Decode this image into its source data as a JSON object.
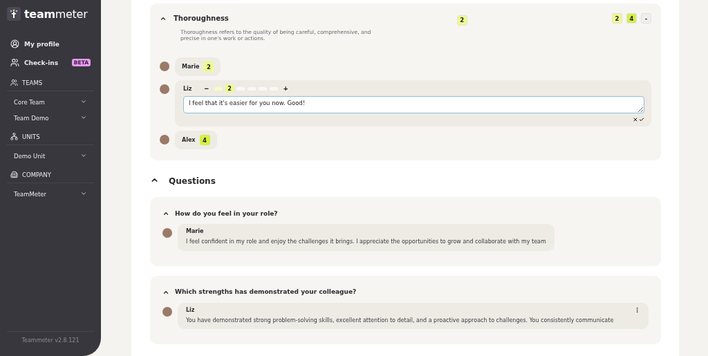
{
  "sidebar": {
    "logo": {
      "bold": "team",
      "light": "meter"
    },
    "nav": [
      {
        "kind": "profile",
        "label": "My profile"
      },
      {
        "kind": "checkins",
        "label": "Check-ins",
        "badge": "BETA"
      }
    ],
    "groups": [
      {
        "kind": "teams",
        "title": "TEAMS",
        "items": [
          {
            "label": "Core Team",
            "expanded": false
          },
          {
            "label": "Team Demo",
            "expanded": false
          }
        ]
      },
      {
        "kind": "units",
        "title": "UNITS",
        "items": [
          {
            "label": "Demo Unit",
            "expanded": false
          }
        ]
      },
      {
        "kind": "company",
        "title": "COMPANY",
        "items": [
          {
            "label": "TeamMeter",
            "expanded": false
          }
        ]
      }
    ],
    "version": "Teammeter v2.8.121"
  },
  "competency": {
    "title": "Thoroughness",
    "expanded": true,
    "description": "Thoroughness refers to the quality of being careful, comprehensive, and precise in one's work or actions.",
    "own_score": {
      "value": "2",
      "color": "#eefa8f"
    },
    "scores": [
      {
        "value": "2",
        "color": "#eefa8f"
      },
      {
        "value": "4",
        "color": "#d6ef48"
      },
      {
        "value": "-",
        "color": "#eeeef0"
      }
    ],
    "ratings": [
      {
        "kind": "score",
        "name": "Marie",
        "score": {
          "value": "2",
          "color": "#eefa8f"
        }
      },
      {
        "kind": "edit",
        "name": "Liz",
        "minus": "−",
        "plus": "+",
        "segments": [
          {
            "filled": true,
            "selected": false
          },
          {
            "filled": true,
            "selected": true,
            "label": "2"
          },
          {
            "filled": false,
            "selected": false
          },
          {
            "filled": false,
            "selected": false
          },
          {
            "filled": false,
            "selected": false
          },
          {
            "filled": false,
            "selected": false
          }
        ],
        "comment": "I feel that it's easier for you now. Good!"
      },
      {
        "kind": "score",
        "name": "Alex",
        "score": {
          "value": "4",
          "color": "#d6ef48"
        }
      }
    ]
  },
  "questions": {
    "title": "Questions",
    "expanded": true,
    "items": [
      {
        "question": "How do you feel in your role?",
        "expanded": true,
        "answers": [
          {
            "name": "Marie",
            "text": "I feel confident in my role and enjoy the challenges it brings. I appreciate the opportunities to grow and collaborate with my team",
            "menu": false
          }
        ]
      },
      {
        "question": "Which strengths has demonstrated your colleague?",
        "expanded": true,
        "answers": [
          {
            "name": "Liz",
            "text": "You have demonstrated strong problem-solving skills, excellent attention to detail, and a proactive approach to challenges. You consistently communicate",
            "menu": true
          }
        ]
      }
    ]
  }
}
